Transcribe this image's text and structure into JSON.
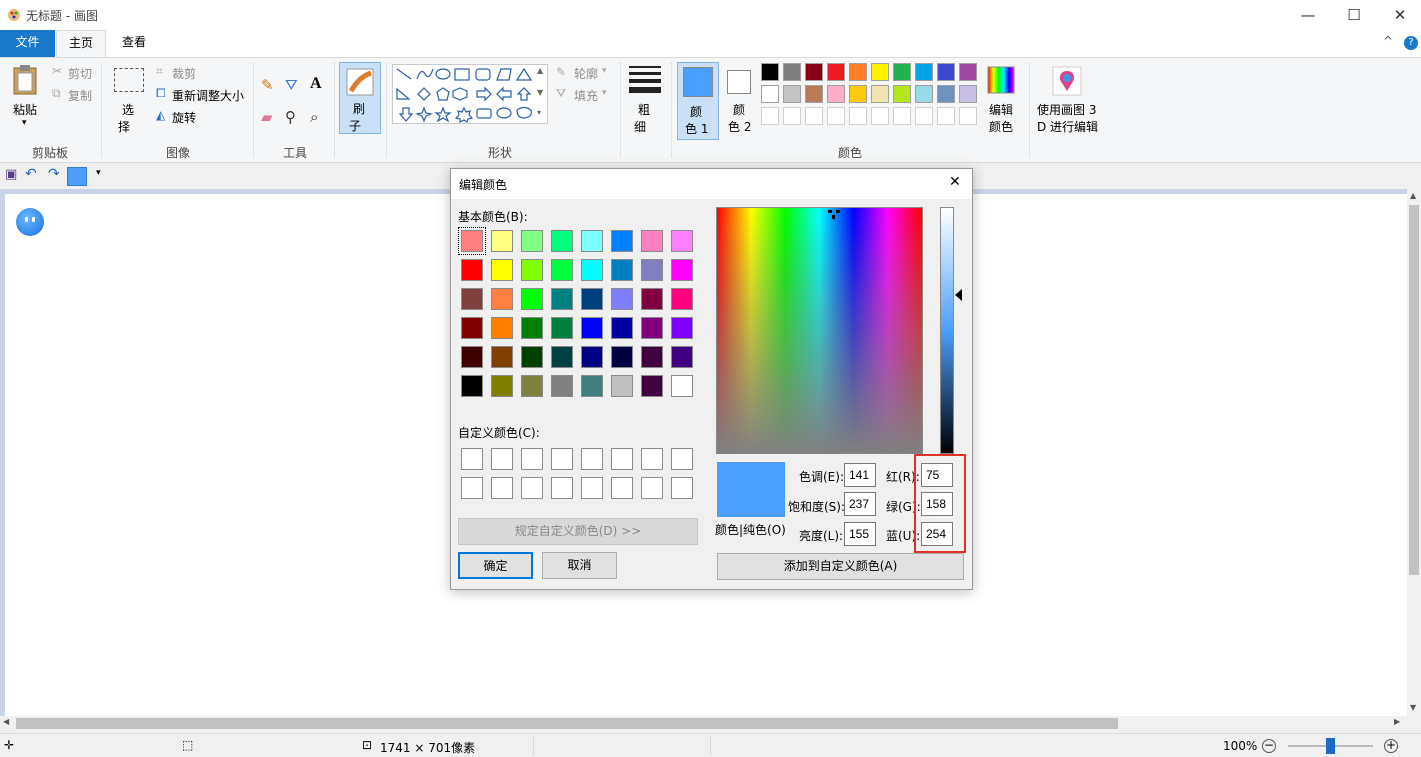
{
  "window": {
    "title": "无标题 - 画图",
    "minimize": "—",
    "maximize": "☐",
    "close": "✕"
  },
  "tabs": {
    "file": "文件",
    "home": "主页",
    "view": "查看",
    "collapse": "^",
    "help": "?"
  },
  "ribbon": {
    "clipboard": {
      "paste": "粘贴",
      "cut": "剪切",
      "copy": "复制",
      "group": "剪贴板"
    },
    "image": {
      "select_line1": "选",
      "select_line2": "择",
      "crop": "裁剪",
      "resize": "重新调整大小",
      "rotate": "旋转",
      "group": "图像"
    },
    "tools": {
      "group": "工具"
    },
    "brushes": {
      "line1": "刷",
      "line2": "子"
    },
    "shapes": {
      "outline": "轮廓",
      "fill": "填充",
      "group": "形状"
    },
    "size": {
      "line1": "粗",
      "line2": "细"
    },
    "colors": {
      "color1_line1": "颜",
      "color1_line2": "色 1",
      "color2_line1": "颜",
      "color2_line2": "色 2",
      "edit_line1": "编辑",
      "edit_line2": "颜色",
      "group": "颜色",
      "color1": "#4b9efe",
      "color2": "#ffffff",
      "palette_row1": [
        "#000000",
        "#7f7f7f",
        "#880015",
        "#ed1c24",
        "#ff7f27",
        "#fff200",
        "#22b14c",
        "#00a2e8",
        "#3f48cc",
        "#a349a4"
      ],
      "palette_row2": [
        "#ffffff",
        "#c3c3c3",
        "#b97a57",
        "#ffaec9",
        "#ffc90e",
        "#efe4b0",
        "#b5e61d",
        "#99d9ea",
        "#7092be",
        "#c8bfe7"
      ]
    },
    "paint3d": {
      "line1": "使用画图 3",
      "line2": "D 进行编辑"
    }
  },
  "status": {
    "dimensions": "1741 × 701像素",
    "zoom": "100%"
  },
  "dialog": {
    "title": "编辑颜色",
    "basic_label": "基本颜色(B):",
    "custom_label": "自定义颜色(C):",
    "define_custom": "规定自定义颜色(D) >>",
    "ok": "确定",
    "cancel": "取消",
    "color_solid": "颜色|纯色(O)",
    "add_custom": "添加到自定义颜色(A)",
    "hue_label": "色调(E):",
    "hue": "141",
    "sat_label": "饱和度(S):",
    "sat": "237",
    "lum_label": "亮度(L):",
    "lum": "155",
    "red_label": "红(R):",
    "red": "75",
    "green_label": "绿(G):",
    "green": "158",
    "blue_label": "蓝(U):",
    "blue": "254",
    "preview_color": "#4b9efe",
    "basic_colors": [
      [
        "#ff8080",
        "#ffff80",
        "#80ff80",
        "#00ff80",
        "#80ffff",
        "#0080ff",
        "#ff80c0",
        "#ff80ff"
      ],
      [
        "#ff0000",
        "#ffff00",
        "#80ff00",
        "#00ff40",
        "#00ffff",
        "#0080c0",
        "#8080c0",
        "#ff00ff"
      ],
      [
        "#804040",
        "#ff8040",
        "#00ff00",
        "#008080",
        "#004080",
        "#8080ff",
        "#800040",
        "#ff0080"
      ],
      [
        "#800000",
        "#ff8000",
        "#008000",
        "#008040",
        "#0000ff",
        "#0000a0",
        "#800080",
        "#8000ff"
      ],
      [
        "#400000",
        "#804000",
        "#004000",
        "#004040",
        "#000080",
        "#000040",
        "#400040",
        "#400080"
      ],
      [
        "#000000",
        "#808000",
        "#808040",
        "#808080",
        "#408080",
        "#c0c0c0",
        "#400040",
        "#ffffff"
      ]
    ]
  }
}
